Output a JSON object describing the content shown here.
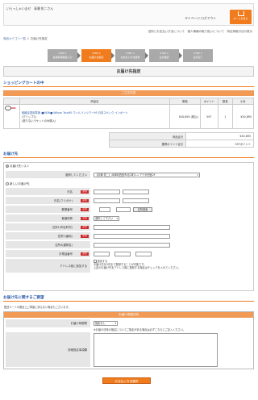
{
  "header": {
    "welcome": "いらっしゃいませ　清瀬 佑二さん",
    "mypage": "マイページ",
    "logout": "ログアウト",
    "cart_button": "カートを見る",
    "sublinks": "送料とお支払い方法について　個人情報の取り扱いについて　特定商取引法の表示"
  },
  "breadcrumb": {
    "home": "商品カテゴリ一覧",
    "sep": " ＞ ",
    "current": "お届け先指定"
  },
  "steps": [
    {
      "num": "STEP 1",
      "label": "会員情報確認入力"
    },
    {
      "num": "STEP 2",
      "label": "お届け先指定"
    },
    {
      "num": "STEP 3",
      "label": "お支払い方法選択"
    },
    {
      "num": "STEP 4",
      "label": "注文確認"
    },
    {
      "num": "STEP 5",
      "label": "注文完了"
    }
  ],
  "page_title": "お届け先指定",
  "cart": {
    "section_title": "ショッピングカートの中",
    "box_title": "ご注文内容",
    "columns": [
      "商品名",
      "単価",
      "ポイント",
      "数量",
      "小計"
    ],
    "item": {
      "name": "錦織圭愛用準拠 ■NEW■ Wilson Tour95 ウィルソンツアー95 日本スペック インポート",
      "detail1": "(グリップ2)",
      "detail2": "(張りないラケットのみ購入)",
      "price": "¥20,895 (税込)",
      "points": "597",
      "qty": "1",
      "subtotal": "¥20,895"
    },
    "totals": [
      {
        "label": "商品合計",
        "value": "¥20,895"
      },
      {
        "label": "獲得ポイント合計",
        "value": "597ポイント"
      }
    ]
  },
  "delivery": {
    "section_title": "お届け先",
    "option_list": "お届け先リスト",
    "select_label": "選択してください",
    "select_value": "【清瀬 佑二】兵庫県西宮市北口町1-1 アクタ西宮2F",
    "option_new": "新しいお届け先",
    "fields": [
      {
        "label": "氏名",
        "required": "必須"
      },
      {
        "label": "氏名(フリガナ)",
        "required": "必須"
      },
      {
        "label": "郵便番号",
        "required": "必須"
      },
      {
        "label": "都道府県",
        "required": "必須"
      },
      {
        "label": "住所1(市区町村)",
        "required": "必須"
      },
      {
        "label": "住所2(番地)",
        "required": "必須"
      },
      {
        "label": "住所3(建物名)",
        "required": ""
      },
      {
        "label": "お電話番号",
        "required": "必須"
      },
      {
        "label": "アドレス帳に追加する",
        "required": ""
      }
    ],
    "zip_button": "住所検索",
    "pref_placeholder": "選択して下さい",
    "addr_check": "追加する",
    "addr_note1": "お届け先を5件まで登録することが可能です。",
    "addr_note2": "上記のお届け先をアドレス帳に登録する場合はチェックを入れてください。"
  },
  "notes": {
    "section_title": "お届け先に関するご要望",
    "intro": "配送ルートの都合上ご希望に添えない場合もございます。",
    "box_title": "お届け希望日時",
    "time_label": "お届け時間帯",
    "time_value": "指定なし",
    "time_note": "※お届け日時の指定についてご指定がある場合は必ずこちらにご記入ください。",
    "request_label": "詳細指定事項欄"
  },
  "next_button": "お支払い方法選択"
}
